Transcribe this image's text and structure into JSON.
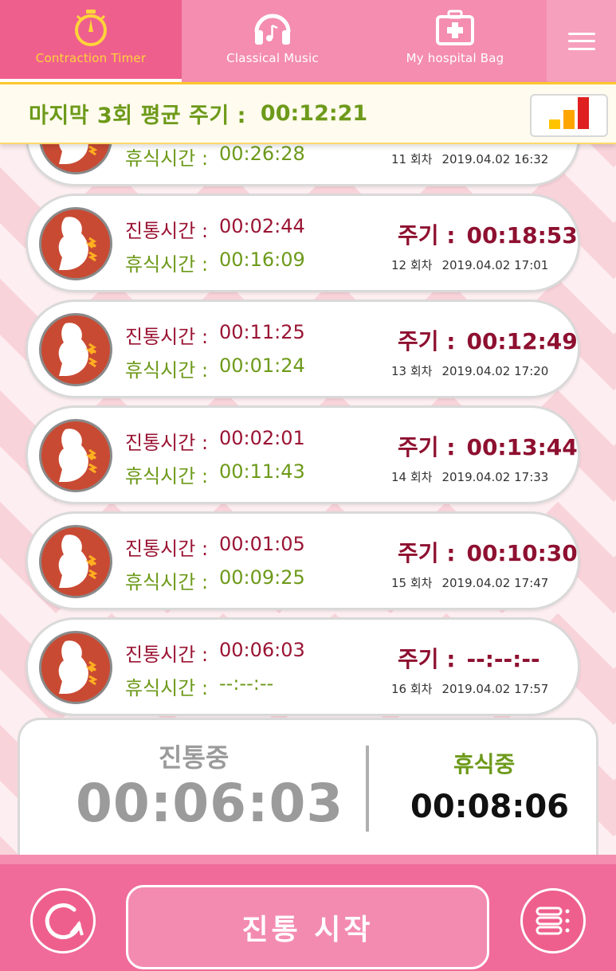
{
  "tabs": [
    {
      "label": "Contraction Timer",
      "icon": "stopwatch-icon",
      "active": true
    },
    {
      "label": "Classical Music",
      "icon": "headphones-icon",
      "active": false
    },
    {
      "label": "My hospital Bag",
      "icon": "medical-bag-icon",
      "active": false
    }
  ],
  "menu_icon": "hamburger-menu-icon",
  "average": {
    "label": "마지막 3회 평균 주기 :",
    "value": "00:12:21"
  },
  "labels": {
    "contraction": "진통시간 :",
    "rest": "휴식시간 :",
    "cycle": "주기 :"
  },
  "records": [
    {
      "contraction": "",
      "rest": "00:26:28",
      "cycle": "",
      "count": "11 회차",
      "datetime": "2019.04.02 16:32"
    },
    {
      "contraction": "00:02:44",
      "rest": "00:16:09",
      "cycle": "00:18:53",
      "count": "12 회차",
      "datetime": "2019.04.02 17:01"
    },
    {
      "contraction": "00:11:25",
      "rest": "00:01:24",
      "cycle": "00:12:49",
      "count": "13 회차",
      "datetime": "2019.04.02 17:20"
    },
    {
      "contraction": "00:02:01",
      "rest": "00:11:43",
      "cycle": "00:13:44",
      "count": "14 회차",
      "datetime": "2019.04.02 17:33"
    },
    {
      "contraction": "00:01:05",
      "rest": "00:09:25",
      "cycle": "00:10:30",
      "count": "15 회차",
      "datetime": "2019.04.02 17:47"
    },
    {
      "contraction": "00:06:03",
      "rest": "--:--:--",
      "cycle": "--:--:--",
      "count": "16 회차",
      "datetime": "2019.04.02 17:57"
    }
  ],
  "timer": {
    "contracting_label": "진통중",
    "contracting_value": "00:06:03",
    "resting_label": "휴식중",
    "resting_value": "00:08:06"
  },
  "bottom": {
    "start_label": "진통 시작",
    "reset_icon": "reset-icon",
    "list_icon": "list-icon"
  },
  "colors": {
    "pink": "#ef5f8e",
    "contraction_red": "#9a1433",
    "rest_green": "#6d9a1a",
    "accent_yellow": "#ffd43a"
  }
}
